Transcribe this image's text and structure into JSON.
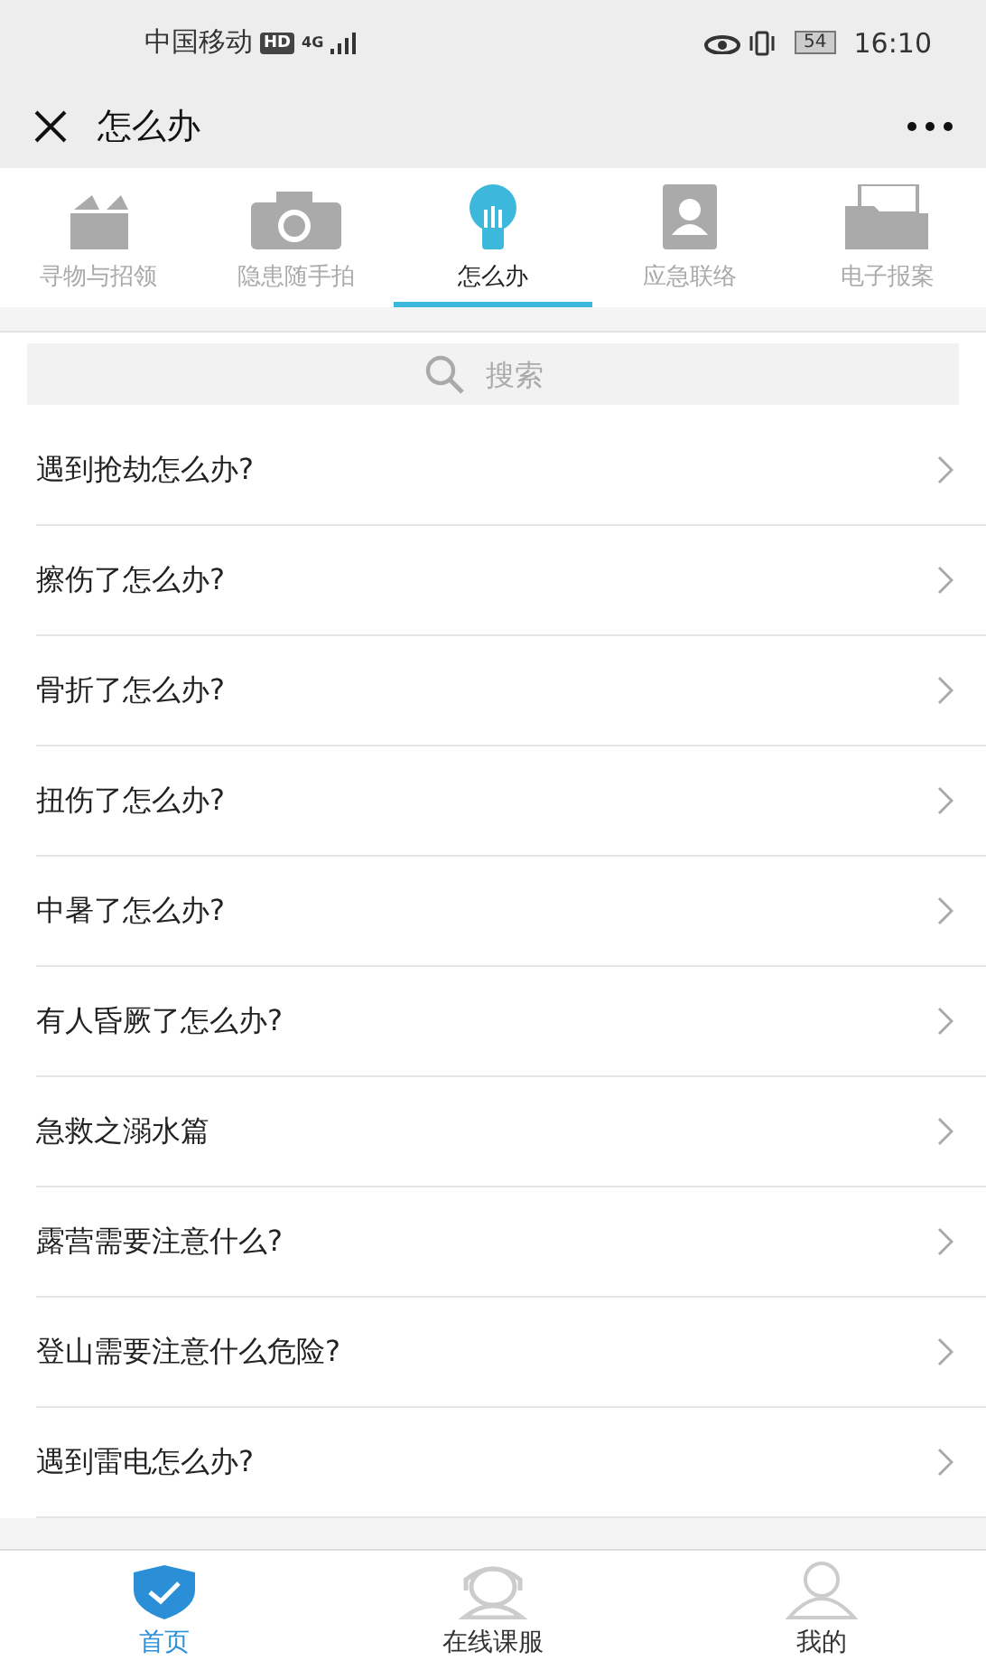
{
  "status_bar": {
    "carrier": "中国移动",
    "hd": "HD",
    "network": "4G",
    "battery": "54",
    "time": "16:10"
  },
  "header": {
    "title": "怎么办"
  },
  "tabs": [
    {
      "label": "寻物与招领",
      "kind": "lost",
      "selected": false
    },
    {
      "label": "隐患随手拍",
      "kind": "camera",
      "selected": false
    },
    {
      "label": "怎么办",
      "kind": "bulb",
      "selected": true
    },
    {
      "label": "应急联络",
      "kind": "contacts",
      "selected": false
    },
    {
      "label": "电子报案",
      "kind": "folder",
      "selected": false
    }
  ],
  "search": {
    "placeholder": "搜索"
  },
  "items": [
    "遇到抢劫怎么办?",
    "擦伤了怎么办?",
    "骨折了怎么办?",
    "扭伤了怎么办?",
    "中暑了怎么办?",
    "有人昏厥了怎么办?",
    "急救之溺水篇",
    "露营需要注意什么?",
    "登山需要注意什么危险?",
    "遇到雷电怎么办?"
  ],
  "bottom_nav": [
    {
      "label": "首页",
      "kind": "home",
      "selected": true
    },
    {
      "label": "在线课服",
      "kind": "service",
      "selected": false
    },
    {
      "label": "我的",
      "kind": "profile",
      "selected": false
    }
  ]
}
